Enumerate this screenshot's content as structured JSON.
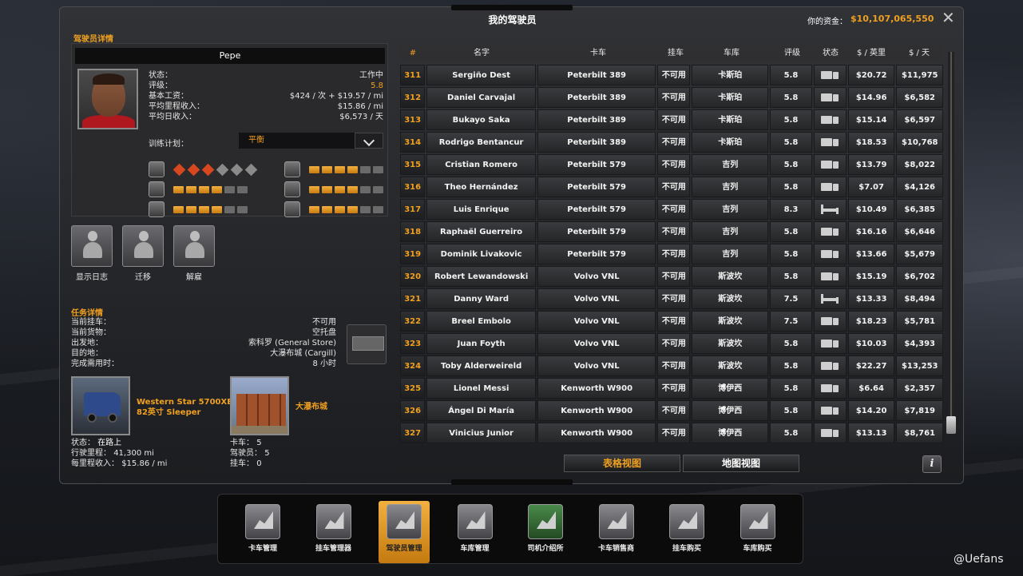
{
  "window": {
    "title": "我的驾驶员",
    "money_label": "你的资金：",
    "money_value": "$10,107,065,550"
  },
  "driver_details": {
    "section_title": "驾驶员详情",
    "name": "Pepe",
    "stats": [
      {
        "label": "状态：",
        "value": "工作中"
      },
      {
        "label": "评级：",
        "value": "5.8"
      },
      {
        "label": "基本工资：",
        "value": "$424 / 次 + $19.57 / mi"
      },
      {
        "label": "平均里程收入：",
        "value": "$15.86 / mi"
      },
      {
        "label": "平均日收入：",
        "value": "$6,573 / 天"
      }
    ],
    "training_label": "训练计划：",
    "training_value": "平衡",
    "skills": {
      "adr_level": 3,
      "adr_total": 6,
      "long_distance": 4,
      "fragile": 4,
      "high_value": 4,
      "urgent": 4,
      "eco_driving": 4,
      "pip_total": 6
    }
  },
  "actions": {
    "log": "显示日志",
    "relocate": "迁移",
    "fire": "解雇"
  },
  "job_details": {
    "section_title": "任务详情",
    "rows": [
      {
        "label": "当前挂车：",
        "value": "不可用"
      },
      {
        "label": "当前货物：",
        "value": "空托盘"
      },
      {
        "label": "出发地：",
        "value": "索科罗 (General Store)"
      },
      {
        "label": "目的地：",
        "value": "大瀑布城 (Cargill)"
      },
      {
        "label": "完成需用时：",
        "value": "8 小时"
      }
    ]
  },
  "truck": {
    "name_line1": "Western Star 5700XE",
    "name_line2": "82英寸 Sleeper",
    "status_label": "状态：",
    "status_value": "在路上",
    "mileage_label": "行驶里程：",
    "mileage_value": "41,300 mi",
    "income_label": "每里程收入：",
    "income_value": "$15.86 / mi"
  },
  "garage": {
    "name": "大瀑布城",
    "trucks_label": "卡车：",
    "trucks_value": "5",
    "drivers_label": "驾驶员：",
    "drivers_value": "5",
    "trailers_label": "挂车：",
    "trailers_value": "0"
  },
  "table": {
    "headers": [
      "#",
      "名字",
      "卡车",
      "挂车",
      "车库",
      "评级",
      "状态",
      "$ / 英里",
      "$ / 天"
    ],
    "rows": [
      {
        "num": "311",
        "name": "Sergiño Dest",
        "truck": "Peterbilt 389",
        "trailer": "不可用",
        "garage": "卡斯珀",
        "rating": "5.8",
        "status": "driving",
        "per_mile": "$20.72",
        "per_day": "$11,975"
      },
      {
        "num": "312",
        "name": "Daniel Carvajal",
        "truck": "Peterbilt 389",
        "trailer": "不可用",
        "garage": "卡斯珀",
        "rating": "5.8",
        "status": "driving",
        "per_mile": "$14.96",
        "per_day": "$6,582"
      },
      {
        "num": "313",
        "name": "Bukayo Saka",
        "truck": "Peterbilt 389",
        "trailer": "不可用",
        "garage": "卡斯珀",
        "rating": "5.8",
        "status": "driving",
        "per_mile": "$15.14",
        "per_day": "$6,597"
      },
      {
        "num": "314",
        "name": "Rodrigo Bentancur",
        "truck": "Peterbilt 389",
        "trailer": "不可用",
        "garage": "卡斯珀",
        "rating": "5.8",
        "status": "driving",
        "per_mile": "$18.53",
        "per_day": "$10,768"
      },
      {
        "num": "315",
        "name": "Cristian Romero",
        "truck": "Peterbilt 579",
        "trailer": "不可用",
        "garage": "吉列",
        "rating": "5.8",
        "status": "driving",
        "per_mile": "$13.79",
        "per_day": "$8,022"
      },
      {
        "num": "316",
        "name": "Theo Hernández",
        "truck": "Peterbilt 579",
        "trailer": "不可用",
        "garage": "吉列",
        "rating": "5.8",
        "status": "driving",
        "per_mile": "$7.07",
        "per_day": "$4,126"
      },
      {
        "num": "317",
        "name": "Luis Enrique",
        "truck": "Peterbilt 579",
        "trailer": "不可用",
        "garage": "吉列",
        "rating": "8.3",
        "status": "resting",
        "per_mile": "$10.49",
        "per_day": "$6,385"
      },
      {
        "num": "318",
        "name": "Raphaël Guerreiro",
        "truck": "Peterbilt 579",
        "trailer": "不可用",
        "garage": "吉列",
        "rating": "5.8",
        "status": "driving",
        "per_mile": "$16.16",
        "per_day": "$6,646"
      },
      {
        "num": "319",
        "name": "Dominik Livakovic",
        "truck": "Peterbilt 579",
        "trailer": "不可用",
        "garage": "吉列",
        "rating": "5.8",
        "status": "driving",
        "per_mile": "$13.66",
        "per_day": "$5,679"
      },
      {
        "num": "320",
        "name": "Robert Lewandowski",
        "truck": "Volvo VNL",
        "trailer": "不可用",
        "garage": "斯波坎",
        "rating": "5.8",
        "status": "driving",
        "per_mile": "$15.19",
        "per_day": "$6,702"
      },
      {
        "num": "321",
        "name": "Danny Ward",
        "truck": "Volvo VNL",
        "trailer": "不可用",
        "garage": "斯波坎",
        "rating": "7.5",
        "status": "resting",
        "per_mile": "$13.33",
        "per_day": "$8,494"
      },
      {
        "num": "322",
        "name": "Breel Embolo",
        "truck": "Volvo VNL",
        "trailer": "不可用",
        "garage": "斯波坎",
        "rating": "7.5",
        "status": "driving",
        "per_mile": "$18.23",
        "per_day": "$5,781"
      },
      {
        "num": "323",
        "name": "Juan Foyth",
        "truck": "Volvo VNL",
        "trailer": "不可用",
        "garage": "斯波坎",
        "rating": "5.8",
        "status": "driving",
        "per_mile": "$10.03",
        "per_day": "$4,393"
      },
      {
        "num": "324",
        "name": "Toby Alderweireld",
        "truck": "Volvo VNL",
        "trailer": "不可用",
        "garage": "斯波坎",
        "rating": "5.8",
        "status": "driving",
        "per_mile": "$22.27",
        "per_day": "$13,253"
      },
      {
        "num": "325",
        "name": "Lionel Messi",
        "truck": "Kenworth W900",
        "trailer": "不可用",
        "garage": "博伊西",
        "rating": "5.8",
        "status": "driving",
        "per_mile": "$6.64",
        "per_day": "$2,357"
      },
      {
        "num": "326",
        "name": "Ángel Di María",
        "truck": "Kenworth W900",
        "trailer": "不可用",
        "garage": "博伊西",
        "rating": "5.8",
        "status": "driving",
        "per_mile": "$14.20",
        "per_day": "$7,819"
      },
      {
        "num": "327",
        "name": "Vinicius Junior",
        "truck": "Kenworth W900",
        "trailer": "不可用",
        "garage": "博伊西",
        "rating": "5.8",
        "status": "driving",
        "per_mile": "$13.13",
        "per_day": "$8,761"
      }
    ]
  },
  "views": {
    "table_view": "表格视图",
    "map_view": "地图视图",
    "info": "i"
  },
  "dock": [
    {
      "label": "卡车管理",
      "icon": "truck-chart-icon",
      "active": false
    },
    {
      "label": "挂车管理器",
      "icon": "trailer-chart-icon",
      "active": false
    },
    {
      "label": "驾驶员管理",
      "icon": "drivers-chart-icon",
      "active": true
    },
    {
      "label": "车库管理",
      "icon": "garage-map-icon",
      "active": false
    },
    {
      "label": "司机介绍所",
      "icon": "recruitment-icon",
      "active": false
    },
    {
      "label": "卡车销售商",
      "icon": "truck-dealer-icon",
      "active": false
    },
    {
      "label": "挂车购买",
      "icon": "trailer-buy-icon",
      "active": false
    },
    {
      "label": "车库购买",
      "icon": "garage-buy-icon",
      "active": false
    }
  ],
  "watermark": "@Uefans",
  "colors": {
    "accent": "#f0a020",
    "active_dock": "#e8a020"
  }
}
